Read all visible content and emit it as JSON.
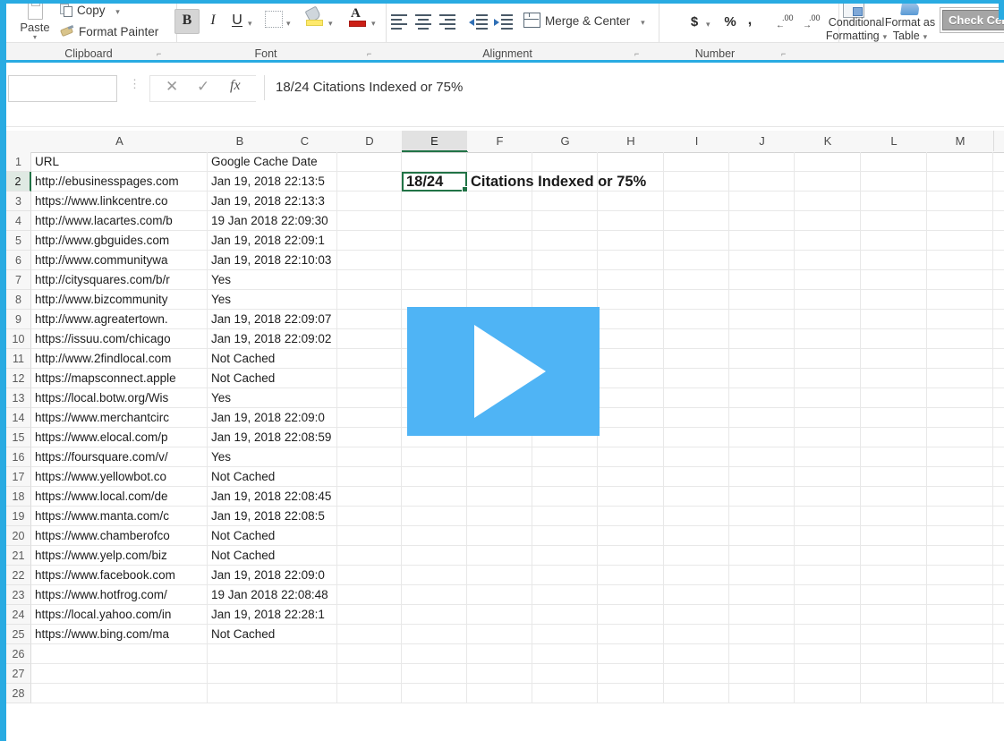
{
  "app": {
    "name": "Microsoft Excel",
    "accent_color": "#217346",
    "frame_color": "#29ABE2"
  },
  "ribbon": {
    "groups": [
      {
        "label": "Clipboard",
        "dialog_launcher": "⌐"
      },
      {
        "label": "Font",
        "dialog_launcher": "⌐"
      },
      {
        "label": "Alignment",
        "dialog_launcher": "⌐"
      },
      {
        "label": "Number",
        "dialog_launcher": "⌐"
      }
    ],
    "clipboard": {
      "paste_label": "Paste",
      "paste_arrow": "▾",
      "copy_label": "Copy",
      "copy_arrow": "▾",
      "format_painter_label": "Format Painter"
    },
    "font": {
      "bold_label": "B",
      "italic_label": "I",
      "underline_label": "U",
      "underline_arrow": "▾",
      "borders_arrow": "▾",
      "fill_arrow": "▾",
      "font_color_letter": "A",
      "font_color_arrow": "▾"
    },
    "alignment": {
      "merge_center_label": "Merge & Center",
      "merge_arrow": "▾"
    },
    "number": {
      "currency_label": "$",
      "currency_arrow": "▾",
      "percent_label": "%",
      "comma_label": ",",
      "increase_decimal": ".00",
      "decrease_decimal": ".00"
    },
    "styles": {
      "conditional_formatting_line1": "Conditional",
      "conditional_formatting_line2": "Formatting",
      "conditional_formatting_arrow": "▾",
      "format_as_line1": "Format as",
      "format_as_line2": "Table",
      "format_as_arrow": "▾",
      "cell_style_preview": "Check Cell"
    }
  },
  "formula_bar": {
    "name_box_value": "",
    "name_box_placeholder": "",
    "cancel_icon": "✕",
    "confirm_icon": "✓",
    "fx_icon": "fx",
    "formula_value": "18/24 Citations Indexed or 75%"
  },
  "sheet": {
    "active_cell": "E2",
    "columns": [
      {
        "id": "A",
        "label": "A",
        "width": 197,
        "active": false
      },
      {
        "id": "B",
        "label": "B",
        "width": 72,
        "active": false
      },
      {
        "id": "C",
        "label": "C",
        "width": 73,
        "active": false
      },
      {
        "id": "D",
        "label": "D",
        "width": 72,
        "active": false
      },
      {
        "id": "E",
        "label": "E",
        "width": 73,
        "active": true
      },
      {
        "id": "F",
        "label": "F",
        "width": 73,
        "active": false
      },
      {
        "id": "G",
        "label": "G",
        "width": 73,
        "active": false
      },
      {
        "id": "H",
        "label": "H",
        "width": 74,
        "active": false
      },
      {
        "id": "I",
        "label": "I",
        "width": 73,
        "active": false
      },
      {
        "id": "J",
        "label": "J",
        "width": 73,
        "active": false
      },
      {
        "id": "K",
        "label": "K",
        "width": 74,
        "active": false
      },
      {
        "id": "L",
        "label": "L",
        "width": 74,
        "active": false
      },
      {
        "id": "M",
        "label": "M",
        "width": 74,
        "active": false
      }
    ],
    "rows": [
      {
        "num": "1",
        "a": "URL",
        "b": "Google Cache Date"
      },
      {
        "num": "2",
        "a": "http://ebusinesspages.com",
        "b": "Jan 19, 2018 22:13:5"
      },
      {
        "num": "3",
        "a": "https://www.linkcentre.co",
        "b": "Jan 19, 2018 22:13:3"
      },
      {
        "num": "4",
        "a": "http://www.lacartes.com/b",
        "b": "19 Jan 2018 22:09:30"
      },
      {
        "num": "5",
        "a": "http://www.gbguides.com",
        "b": "Jan 19, 2018 22:09:1"
      },
      {
        "num": "6",
        "a": "http://www.communitywa",
        "b": "Jan 19, 2018 22:10:03"
      },
      {
        "num": "7",
        "a": "http://citysquares.com/b/r",
        "b": "Yes"
      },
      {
        "num": "8",
        "a": "http://www.bizcommunity",
        "b": "Yes"
      },
      {
        "num": "9",
        "a": "http://www.agreatertown.",
        "b": "Jan 19, 2018 22:09:07"
      },
      {
        "num": "10",
        "a": "https://issuu.com/chicago",
        "b": "Jan 19, 2018 22:09:02"
      },
      {
        "num": "11",
        "a": "http://www.2findlocal.com",
        "b": "Not Cached"
      },
      {
        "num": "12",
        "a": "https://mapsconnect.apple",
        "b": "Not Cached"
      },
      {
        "num": "13",
        "a": "https://local.botw.org/Wis",
        "b": "Yes"
      },
      {
        "num": "14",
        "a": "https://www.merchantcirc",
        "b": "Jan 19, 2018 22:09:0"
      },
      {
        "num": "15",
        "a": "https://www.elocal.com/p",
        "b": "Jan 19, 2018 22:08:59"
      },
      {
        "num": "16",
        "a": "https://foursquare.com/v/",
        "b": "Yes"
      },
      {
        "num": "17",
        "a": "https://www.yellowbot.co",
        "b": "Not Cached"
      },
      {
        "num": "18",
        "a": "https://www.local.com/de",
        "b": "Jan 19, 2018 22:08:45"
      },
      {
        "num": "19",
        "a": "https://www.manta.com/c",
        "b": "Jan 19, 2018 22:08:5"
      },
      {
        "num": "20",
        "a": "https://www.chamberofco",
        "b": "Not Cached"
      },
      {
        "num": "21",
        "a": "https://www.yelp.com/biz",
        "b": "Not Cached"
      },
      {
        "num": "22",
        "a": "https://www.facebook.com",
        "b": "Jan 19, 2018 22:09:0"
      },
      {
        "num": "23",
        "a": "https://www.hotfrog.com/",
        "b": "19 Jan 2018 22:08:48"
      },
      {
        "num": "24",
        "a": "https://local.yahoo.com/in",
        "b": "Jan 19, 2018 22:28:1"
      },
      {
        "num": "25",
        "a": "https://www.bing.com/ma",
        "b": "Not Cached"
      },
      {
        "num": "26",
        "a": "",
        "b": ""
      },
      {
        "num": "27",
        "a": "",
        "b": ""
      },
      {
        "num": "28",
        "a": "",
        "b": ""
      }
    ],
    "selected_cell_value": "18/24",
    "selected_cell_overflow": "Citations Indexed or 75%"
  },
  "video_overlay": {
    "play_button_label": "Play",
    "color": "#4FB4F5"
  }
}
